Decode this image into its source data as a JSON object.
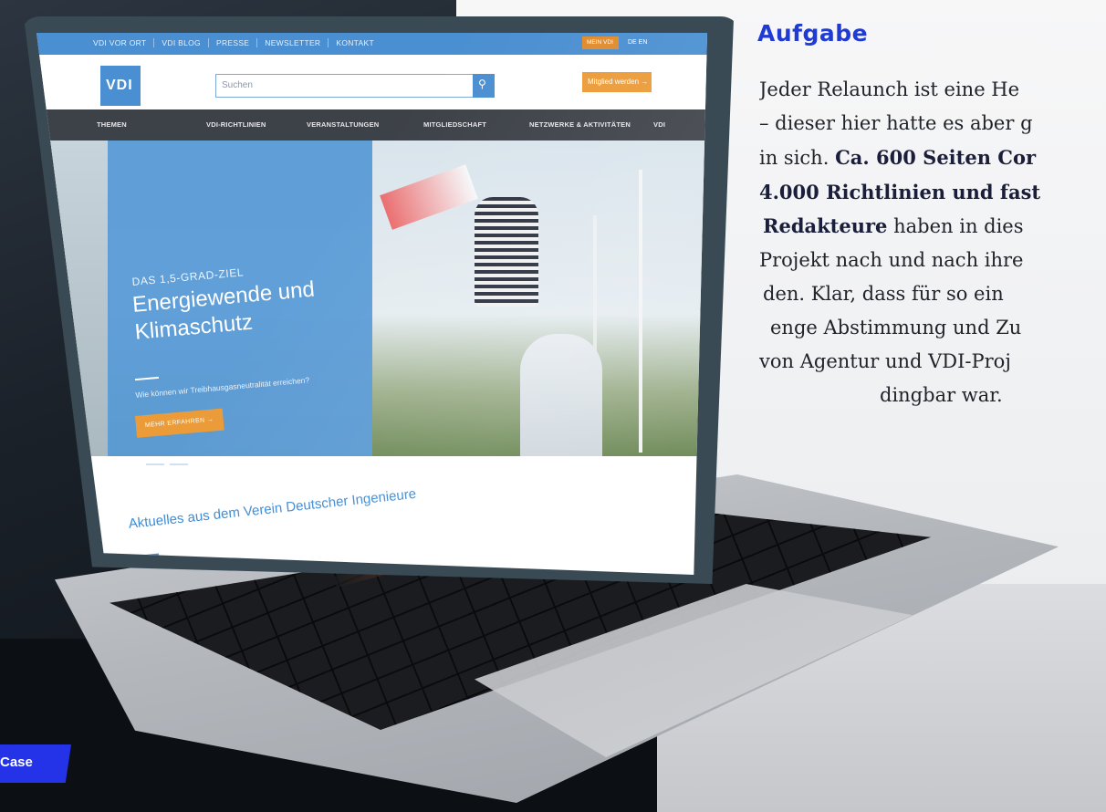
{
  "article": {
    "heading": "Aufgabe",
    "lines": [
      "Jeder Relaunch ist eine He",
      "– dieser hier hatte es aber g",
      "in sich.",
      "Ca. 600 Seiten Cor",
      "4.000 Richtlinien und fast",
      "Redakteure",
      "haben in dies",
      "Projekt nach und nach ihre",
      "den. Klar, dass für so ein",
      "enge Abstimmung und Zu",
      "von Agentur und VDI-Proj",
      "dingbar war."
    ]
  },
  "tag": {
    "label": "Case"
  },
  "website": {
    "topnav": [
      "VDI VOR ORT",
      "VDI BLOG",
      "PRESSE",
      "NEWSLETTER",
      "KONTAKT"
    ],
    "lang_box": "MEIN VDI",
    "lang": "DE  EN",
    "logo": "VDI",
    "search_placeholder": "Suchen",
    "search_icon": "search-icon",
    "member_button": "Mitglied werden →",
    "mainnav": [
      "THEMEN",
      "VDI-RICHTLINIEN",
      "VERANSTALTUNGEN",
      "MITGLIEDSCHAFT",
      "NETZWERKE & AKTIVITÄTEN",
      "VDI"
    ],
    "hero": {
      "eyebrow": "DAS 1,5-GRAD-ZIEL",
      "title": "Energiewende und Klimaschutz",
      "subtitle": "Wie können wir Treibhausgasneutralität erreichen?",
      "cta": "MEHR ERFAHREN →"
    },
    "news_title": "Aktuelles aus dem Verein Deutscher Ingenieure"
  },
  "colors": {
    "heading_blue": "#1f3bd1",
    "vdi_blue": "#4a8fd1",
    "orange": "#eb9b38",
    "nav_dark": "#3d4148"
  }
}
